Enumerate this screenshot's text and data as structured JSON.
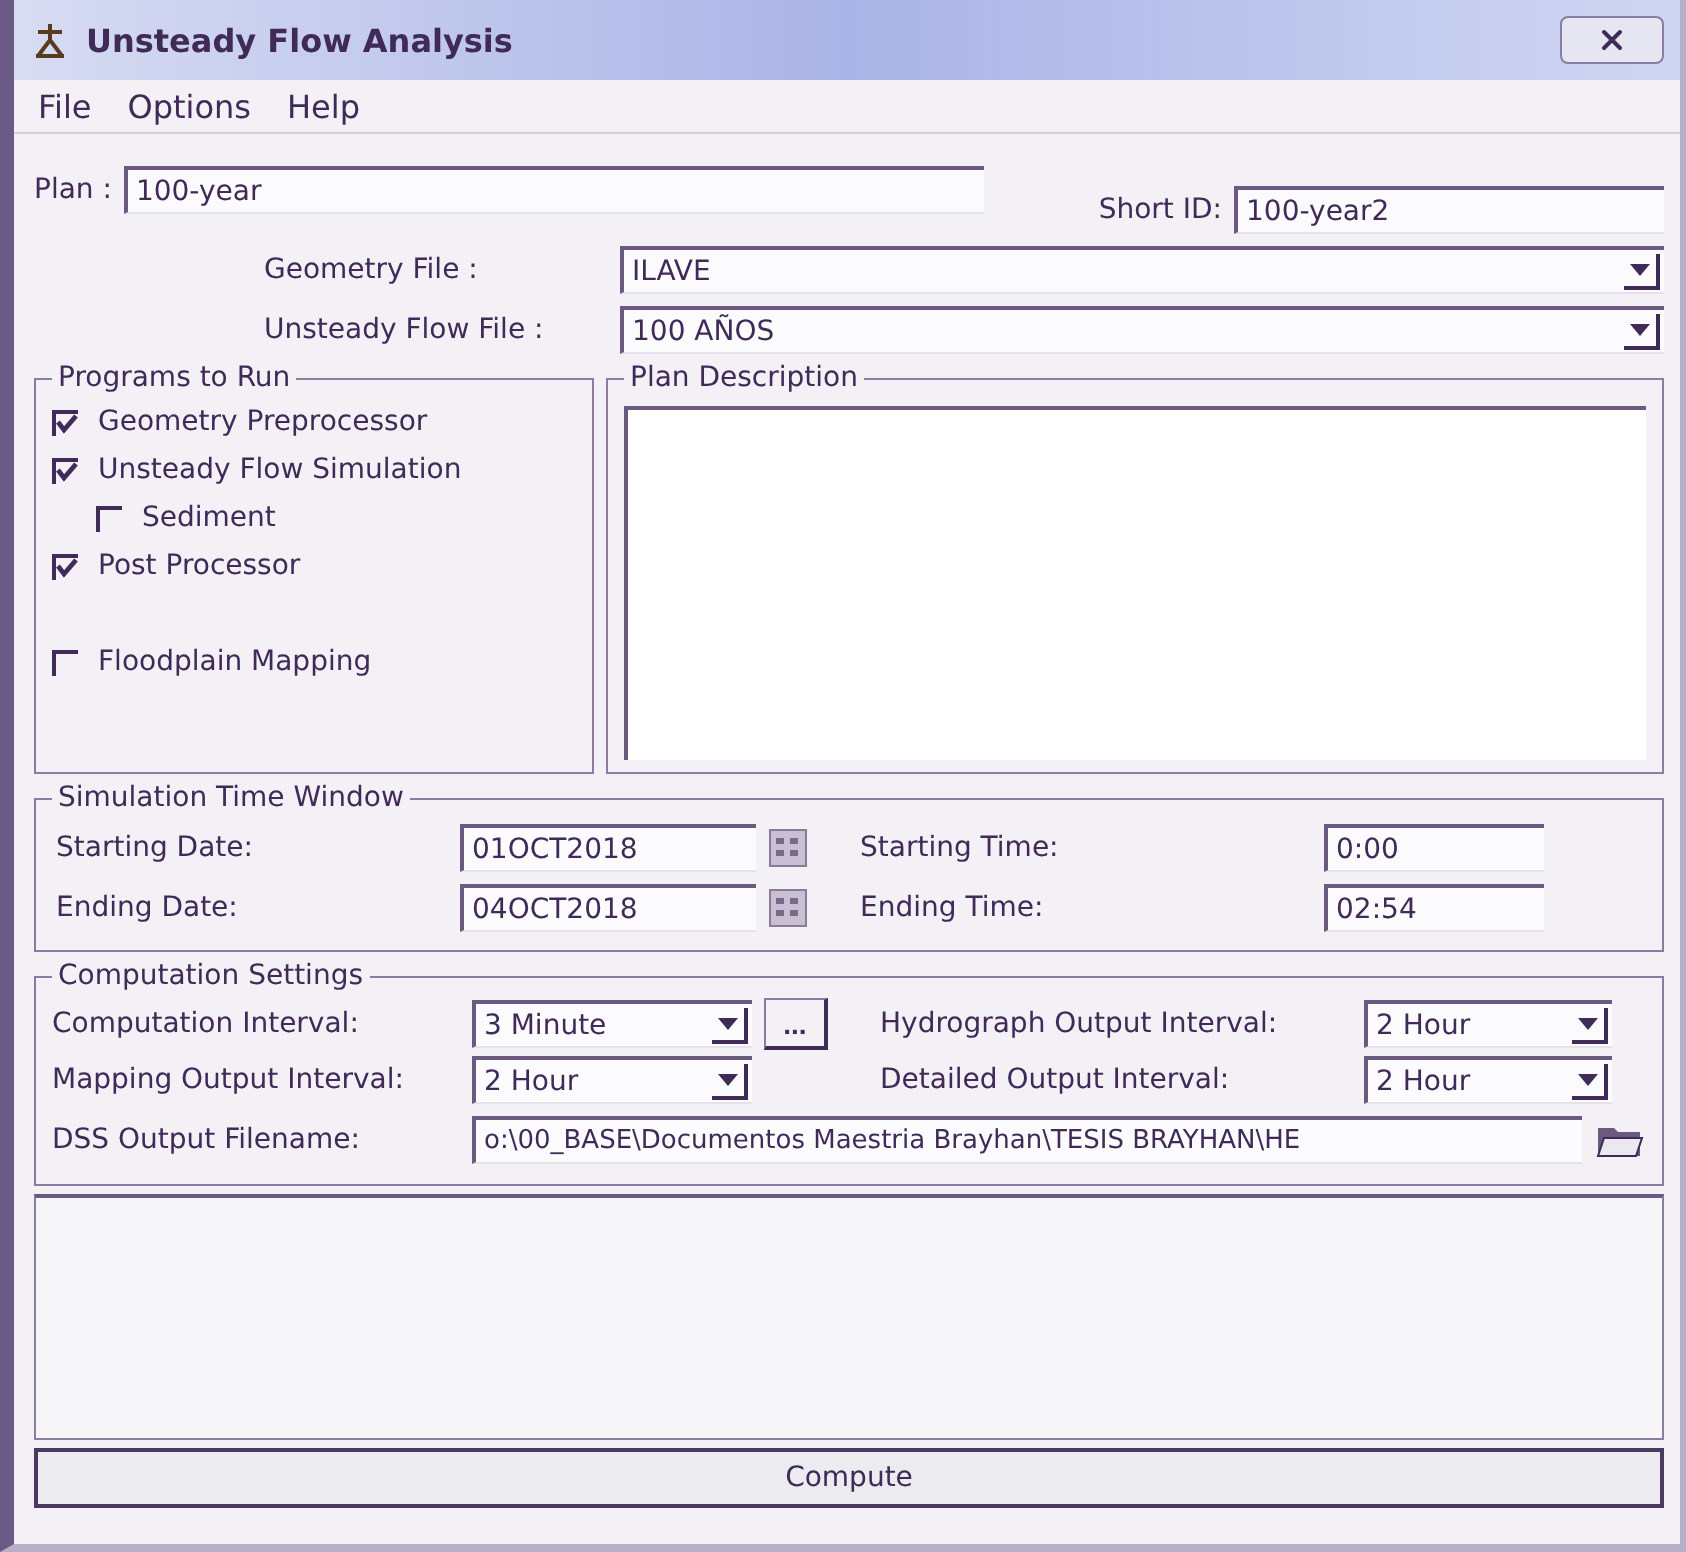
{
  "window": {
    "title": "Unsteady Flow Analysis"
  },
  "menu": [
    "File",
    "Options",
    "Help"
  ],
  "plan": {
    "label": "Plan :",
    "value": "100-year"
  },
  "short_id": {
    "label": "Short ID:",
    "value": "100-year2"
  },
  "file_selects": [
    {
      "label": "Geometry File :",
      "value": "ILAVE"
    },
    {
      "label": "Unsteady Flow File :",
      "value": "100 AÑOS"
    }
  ],
  "programs": {
    "title": "Programs to Run",
    "items": [
      {
        "label": "Geometry Preprocessor",
        "checked": true
      },
      {
        "label": "Unsteady Flow Simulation",
        "checked": true,
        "children": [
          {
            "label": "Sediment",
            "checked": false
          }
        ]
      },
      {
        "label": "Post Processor",
        "checked": true
      },
      {
        "label": "Floodplain Mapping",
        "checked": false
      }
    ]
  },
  "plan_description": {
    "title": "Plan Description"
  },
  "simulation_time_window": {
    "title": "Simulation Time Window",
    "rows": [
      {
        "date_label": "Starting Date:",
        "date": "01OCT2018",
        "time_label": "Starting Time:",
        "time": "0:00"
      },
      {
        "date_label": "Ending Date:",
        "date": "04OCT2018",
        "time_label": "Ending Time:",
        "time": "02:54"
      }
    ]
  },
  "computation_settings": {
    "title": "Computation Settings",
    "computation_interval": {
      "label": "Computation Interval:",
      "value": "3 Minute",
      "button": "..."
    },
    "hydrograph_output_interval": {
      "label": "Hydrograph Output Interval:",
      "value": "2 Hour"
    },
    "mapping_output_interval": {
      "label": "Mapping Output Interval:",
      "value": "2 Hour"
    },
    "detailed_output_interval": {
      "label": "Detailed Output Interval:",
      "value": "2 Hour"
    },
    "dss_output_filename": {
      "label": "DSS Output Filename:",
      "value": "o:\\00_BASE\\Documentos Maestria Brayhan\\TESIS BRAYHAN\\HE"
    }
  },
  "compute_button": "Compute"
}
